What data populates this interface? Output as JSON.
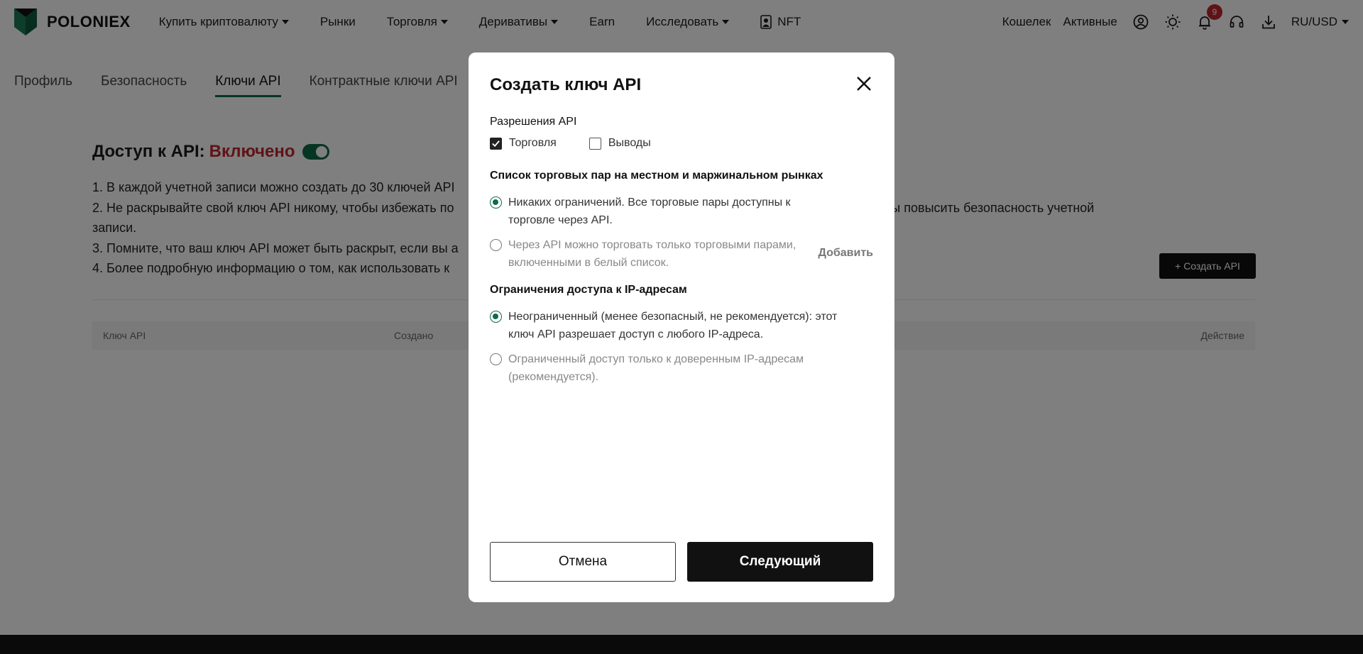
{
  "brand": {
    "name": "POLONIEX",
    "accent": "#0f6b48"
  },
  "nav": {
    "items": [
      {
        "label": "Купить криптовалюту",
        "has_dropdown": true
      },
      {
        "label": "Рынки",
        "has_dropdown": false
      },
      {
        "label": "Торговля",
        "has_dropdown": true
      },
      {
        "label": "Деривативы",
        "has_dropdown": true
      },
      {
        "label": "Earn",
        "has_dropdown": false
      },
      {
        "label": "Исследовать",
        "has_dropdown": true
      },
      {
        "label": "NFT",
        "has_dropdown": false
      }
    ],
    "wallet": "Кошелек",
    "assets": "Активные",
    "notification_count": "9",
    "locale": "RU/USD",
    "icons": [
      "user-icon",
      "sun-icon",
      "bell-icon",
      "headset-icon",
      "download-icon"
    ]
  },
  "tabs": [
    {
      "label": "Профиль",
      "active": false
    },
    {
      "label": "Безопасность",
      "active": false
    },
    {
      "label": "Ключи API",
      "active": true
    },
    {
      "label": "Контрактные ключи API",
      "active": false
    }
  ],
  "page": {
    "title_prefix": "Доступ к API:",
    "status": "Включено",
    "status_color": "#c0272d",
    "notes": [
      "1. В каждой учетной записи можно создать до 30 ключей API",
      "2. Не раскрывайте свой ключ API никому, чтобы избежать по",
      "бы повысить безопасность учетной",
      "записи.",
      "3. Помните, что ваш ключ API может быть раскрыт, если вы а",
      "4. Более подробную информацию о том, как использовать к"
    ],
    "create_button": "+ Создать API",
    "table_headers": {
      "key": "Ключ API",
      "created": "Создано",
      "action": "Действие"
    }
  },
  "modal": {
    "title": "Создать ключ API",
    "permissions_label": "Разрешения API",
    "permissions": [
      {
        "label": "Торговля",
        "checked": true
      },
      {
        "label": "Выводы",
        "checked": false
      }
    ],
    "pairs_label": "Список торговых пар на местном и маржинальном рынках",
    "pairs_options": [
      {
        "text": "Никаких ограничений. Все торговые пары доступны к торговле через API.",
        "selected": true
      },
      {
        "text": "Через API можно торговать только торговыми парами, включенными в белый список.",
        "selected": false
      }
    ],
    "add_label": "Добавить",
    "ip_label": "Ограничения доступа к IP-адресам",
    "ip_options": [
      {
        "text": "Неограниченный (менее безопасный, не рекомендуется): этот ключ API разрешает доступ с любого IP-адреса.",
        "selected": true
      },
      {
        "text": "Ограниченный доступ только к доверенным IP-адресам (рекомендуется).",
        "selected": false
      }
    ],
    "cancel": "Отмена",
    "next": "Следующий"
  }
}
